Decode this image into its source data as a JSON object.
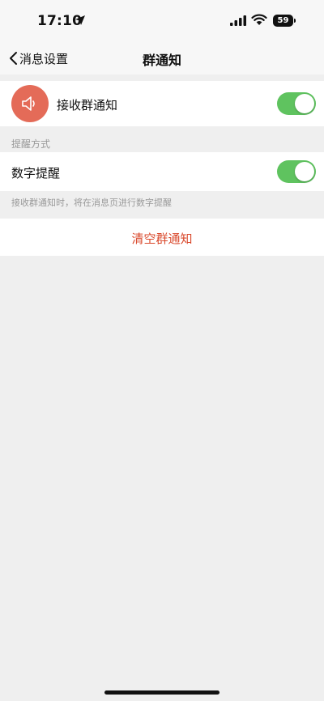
{
  "status_bar": {
    "time": "17:10",
    "battery": "59",
    "icons": [
      "location-arrow-icon",
      "cellular-signal-icon",
      "wifi-icon",
      "battery-icon"
    ]
  },
  "nav": {
    "back_label": "消息设置",
    "title": "群通知"
  },
  "receive_row": {
    "label": "接收群通知",
    "icon": "speaker-icon",
    "icon_bg": "#e46b58",
    "toggle_on": true
  },
  "section": {
    "label": "提醒方式"
  },
  "digit_row": {
    "label": "数字提醒",
    "toggle_on": true
  },
  "hint": "接收群通知时，将在消息页进行数字提醒",
  "clear_button": {
    "label": "清空群通知",
    "color": "#d9482b"
  },
  "colors": {
    "toggle_on": "#5fc35f",
    "background": "#efefef"
  }
}
